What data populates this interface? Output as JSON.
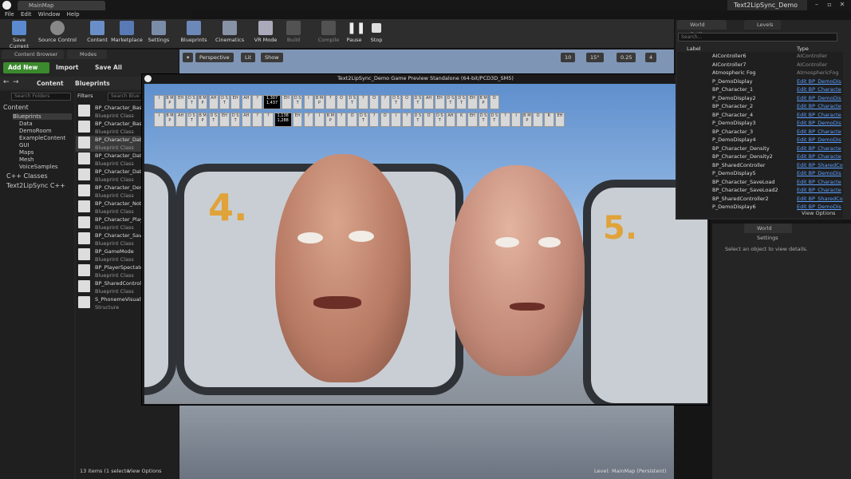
{
  "window": {
    "tab": "MainMap",
    "title": "Text2LipSync_Demo"
  },
  "menu": [
    "File",
    "Edit",
    "Window",
    "Help"
  ],
  "toolbar": [
    {
      "label": "Save Current",
      "icon": "save-icon"
    },
    {
      "label": "Source Control",
      "icon": "source-control-icon"
    },
    {
      "label": "Content",
      "icon": "content-icon"
    },
    {
      "label": "Marketplace",
      "icon": "marketplace-icon"
    },
    {
      "label": "Settings",
      "icon": "settings-icon"
    },
    {
      "label": "Blueprints",
      "icon": "blueprints-icon"
    },
    {
      "label": "Cinematics",
      "icon": "cinematics-icon"
    },
    {
      "label": "VR Mode",
      "icon": "vr-icon"
    },
    {
      "label": "Build",
      "icon": "build-icon"
    },
    {
      "label": "Compile",
      "icon": "compile-icon"
    },
    {
      "label": "Pause",
      "icon": "pause-icon"
    },
    {
      "label": "Stop",
      "icon": "stop-icon"
    }
  ],
  "content_browser": {
    "tab": "Content Browser",
    "modes_tab": "Modes",
    "add_new": "Add New",
    "import": "Import",
    "save_all": "Save All",
    "breadcrumb": [
      "Content",
      "Blueprints"
    ],
    "search_folders": "Search Folders",
    "filters": "Filters",
    "search_assets": "Search Blue",
    "tree": [
      "Content",
      "Blueprints",
      "Data",
      "DemoRoom",
      "ExampleContent",
      "GUI",
      "Maps",
      "Mesh",
      "VoiceSamples",
      "C++ Classes",
      "Text2LipSync C++"
    ],
    "assets": [
      {
        "name": "BP_Character_Bas",
        "type": "Blueprint Class"
      },
      {
        "name": "BP_Character_Bas",
        "type": "Blueprint Class"
      },
      {
        "name": "BP_Character_Dat",
        "type": "Blueprint Class"
      },
      {
        "name": "BP_Character_Dat",
        "type": "Blueprint Class"
      },
      {
        "name": "BP_Character_Dat",
        "type": "Blueprint Class"
      },
      {
        "name": "BP_Character_Den",
        "type": "Blueprint Class"
      },
      {
        "name": "BP_Character_Noti",
        "type": "Blueprint Class"
      },
      {
        "name": "BP_Character_Play",
        "type": "Blueprint Class"
      },
      {
        "name": "BP_Character_Sav",
        "type": "Blueprint Class"
      },
      {
        "name": "BP_GameMode",
        "type": "Blueprint Class"
      },
      {
        "name": "BP_PlayerSpectato",
        "type": "Blueprint Class"
      },
      {
        "name": "BP_SharedControl",
        "type": "Blueprint Class"
      },
      {
        "name": "S_PhonemeVisuali",
        "type": "Structure"
      }
    ],
    "status": "13 items (1 selecte",
    "view_options": "View Options"
  },
  "viewport": {
    "perspective": "Perspective",
    "lit": "Lit",
    "show": "Show",
    "grid": "10",
    "angle": "15°",
    "scale": "0.25",
    "cam": "4",
    "level_label": "Level:",
    "level_name": "MainMap (Persistent)"
  },
  "game_window": {
    "title": "Text2LipSync_Demo Game Preview Standalone (64-bit/PCD3D_SM5)",
    "label_left": "4.",
    "label_right": "5.",
    "phoneme_row1": [
      "I",
      "B M P",
      "EH",
      "D S T",
      "B M P",
      "AH",
      "D S T",
      "EH",
      "AH",
      "?",
      "1,307 1,437",
      "EH",
      "D S T",
      "I",
      "B M P",
      "?",
      "O",
      "D S T",
      "?",
      "O",
      "?",
      "D S T",
      "O",
      "D S T",
      "AH",
      "EH",
      "D S T",
      "D S T",
      "EH",
      "B M P",
      "O"
    ],
    "phoneme_row2": [
      "I",
      "B M P",
      "AH",
      "D S T",
      "B M P",
      "D S T",
      "EH",
      "D S T",
      "AH",
      "?",
      "?",
      "1,138 1,288",
      "EH",
      "?",
      "I",
      "B M P",
      "?",
      "O",
      "D S T",
      "?",
      "O",
      "I",
      "?",
      "D S T",
      "O",
      "D S T",
      "AH",
      "K",
      "EH",
      "D S T",
      "D S T",
      "?",
      "I",
      "B M P",
      "O",
      "R",
      "EH"
    ]
  },
  "outliner": {
    "tab": "World Outliner",
    "levels_tab": "Levels",
    "search": "Search...",
    "col_label": "Label",
    "col_type": "Type",
    "rows": [
      {
        "label": "AIController6",
        "type": "AIController",
        "grey": true
      },
      {
        "label": "AIController7",
        "type": "AIController",
        "grey": true
      },
      {
        "label": "Atmospheric Fog",
        "type": "AtmosphericFog",
        "grey": true
      },
      {
        "label": "P_DemoDisplay",
        "type": "Edit BP_DemoDis"
      },
      {
        "label": "BP_Character_1",
        "type": "Edit BP_Characte"
      },
      {
        "label": "P_DemoDisplay2",
        "type": "Edit BP_DemoDis"
      },
      {
        "label": "BP_Character_2",
        "type": "Edit BP_Characte"
      },
      {
        "label": "BP_Character_4",
        "type": "Edit BP_Characte"
      },
      {
        "label": "P_DemoDisplay3",
        "type": "Edit BP_DemoDis"
      },
      {
        "label": "BP_Character_3",
        "type": "Edit BP_Characte"
      },
      {
        "label": "P_DemoDisplay4",
        "type": "Edit BP_DemoDis"
      },
      {
        "label": "BP_Character_Density",
        "type": "Edit BP_Characte"
      },
      {
        "label": "BP_Character_Density2",
        "type": "Edit BP_Characte"
      },
      {
        "label": "BP_SharedController",
        "type": "Edit BP_SharedCo"
      },
      {
        "label": "P_DemoDisplay5",
        "type": "Edit BP_DemoDis"
      },
      {
        "label": "BP_Character_SaveLoad",
        "type": "Edit BP_Characte"
      },
      {
        "label": "BP_Character_SaveLoad2",
        "type": "Edit BP_Characte"
      },
      {
        "label": "BP_SharedController2",
        "type": "Edit BP_SharedCo"
      },
      {
        "label": "P_DemoDisplay6",
        "type": "Edit BP_DemoDis"
      }
    ],
    "view_options": "View Options"
  },
  "details": {
    "tab": "World Settings",
    "empty": "Select an object to view details."
  }
}
